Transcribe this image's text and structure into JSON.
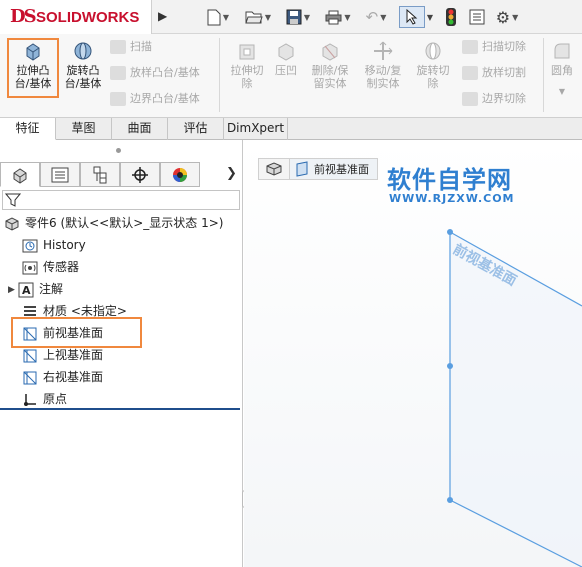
{
  "app": {
    "brand_mark": "DS",
    "brand_name": "SOLIDWORKS"
  },
  "quick_access": {
    "icons": [
      "new-document-icon",
      "open-folder-icon",
      "save-icon",
      "print-icon",
      "undo-icon",
      "select-pointer-icon",
      "traffic-light-icon",
      "file-properties-icon",
      "options-gear-icon"
    ]
  },
  "command_manager": {
    "extrude_boss": "拉伸凸\n台/基体",
    "revolve_boss": "旋转凸\n台/基体",
    "sweep": "扫描",
    "loft_boss": "放样凸台/基体",
    "boundary_boss": "边界凸台/基体",
    "extrude_cut": "拉伸切\n除",
    "indent": "压凹",
    "delete_body": "删除/保\n留实体",
    "move_copy_body": "移动/复\n制实体",
    "revolve_cut": "旋转切\n除",
    "swept_cut": "扫描切除",
    "lofted_cut": "放样切割",
    "boundary_cut": "边界切除",
    "fillet": "圆角"
  },
  "tabs": [
    {
      "label": "特征"
    },
    {
      "label": "草图"
    },
    {
      "label": "曲面"
    },
    {
      "label": "评估"
    },
    {
      "label": "DimXpert"
    }
  ],
  "feature_tree": {
    "root": "零件6  (默认<<默认>_显示状态 1>)",
    "items": [
      {
        "label": "History"
      },
      {
        "label": "传感器"
      },
      {
        "label": "注解"
      },
      {
        "label": "材质 <未指定>"
      },
      {
        "label": "前视基准面"
      },
      {
        "label": "上视基准面"
      },
      {
        "label": "右视基准面"
      },
      {
        "label": "原点"
      }
    ]
  },
  "viewport": {
    "breadcrumb": "前视基准面",
    "plane_label": "前视基准面",
    "watermark_title": "软件自学网",
    "watermark_url": "WWW.RJZXW.COM"
  },
  "colors": {
    "accent_red": "#c8102e",
    "highlight_orange": "#f0883e",
    "plane_blue": "#5a9ee0",
    "watermark_blue": "#2f7fd0"
  }
}
